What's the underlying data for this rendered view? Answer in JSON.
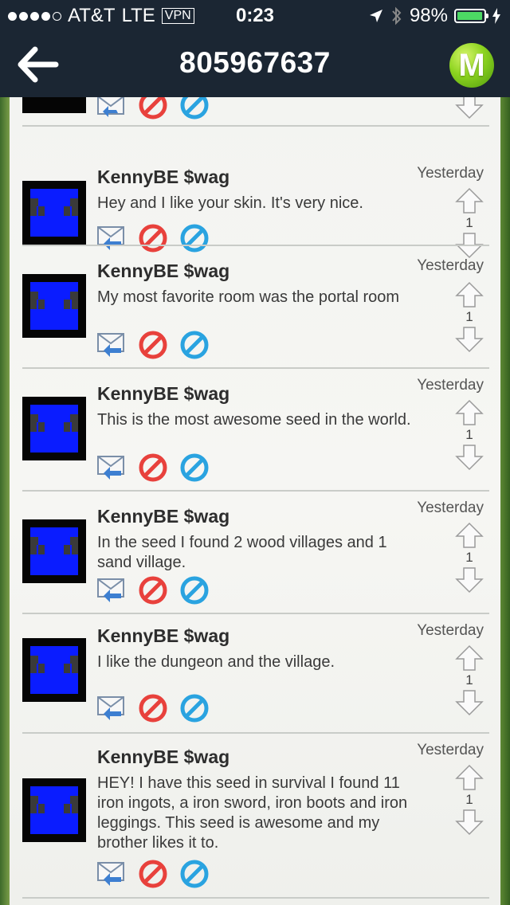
{
  "status_bar": {
    "carrier": "AT&T",
    "network": "LTE",
    "vpn": "VPN",
    "time": "0:23",
    "battery": "98%",
    "battery_level": 0.98
  },
  "nav": {
    "title": "805967637",
    "logo_letter": "M"
  },
  "comments": [
    {
      "author": "KennyBE $wag",
      "text": "Hey and I like your skin. It's very nice.",
      "date": "Yesterday",
      "votes": "1"
    },
    {
      "author": "KennyBE $wag",
      "text": "My most favorite room was the portal room",
      "date": "Yesterday",
      "votes": "1"
    },
    {
      "author": "KennyBE $wag",
      "text": "This is the most awesome seed in the world.",
      "date": "Yesterday",
      "votes": "1"
    },
    {
      "author": "KennyBE $wag",
      "text": "In the seed I found 2 wood villages and 1 sand village.",
      "date": "Yesterday",
      "votes": "1"
    },
    {
      "author": "KennyBE $wag",
      "text": "I like the dungeon and the village.",
      "date": "Yesterday",
      "votes": "1"
    },
    {
      "author": "KennyBE $wag",
      "text": "HEY! I have this seed in survival I found 11 iron ingots, a iron sword, iron boots and iron leggings. This seed is awesome and my brother likes it to.",
      "date": "Yesterday",
      "votes": "1"
    }
  ],
  "colors": {
    "bar_bg": "#1b2633",
    "avatar_blue": "#0a1cff",
    "block_red": "#e8413c",
    "ignore_blue": "#2aa3e0"
  }
}
